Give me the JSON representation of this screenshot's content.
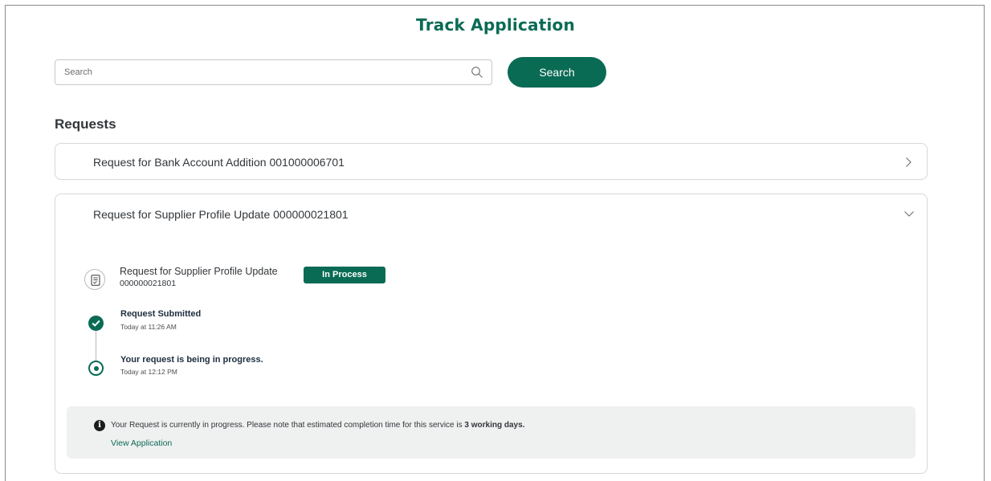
{
  "page": {
    "title": "Track Application"
  },
  "search": {
    "placeholder": "Search",
    "value": "",
    "button_label": "Search"
  },
  "requests": {
    "heading": "Requests",
    "items": [
      {
        "title": "Request for Bank Account Addition 001000006701",
        "expanded": false
      },
      {
        "title": "Request for Supplier Profile Update 000000021801",
        "expanded": true,
        "detail": {
          "name": "Request for Supplier Profile Update",
          "number": "000000021801",
          "status": "In Process",
          "steps": [
            {
              "title": "Request Submitted",
              "time": "Today at 11:26 AM",
              "state": "done"
            },
            {
              "title": "Your request is being in progress.",
              "time": "Today at 12:12 PM",
              "state": "current"
            }
          ],
          "info": {
            "text_prefix": "Your Request is currently in progress. Please note that estimated completion time for this service is ",
            "text_bold": "3 working days.",
            "link_label": "View Application"
          }
        }
      }
    ]
  },
  "colors": {
    "accent": "#0a6b55",
    "panel_bg": "#eff0f0",
    "border": "#d5d7d9"
  },
  "icons": {
    "search": "search-icon",
    "expand": "chevron-right-icon",
    "collapse": "chevron-down-icon",
    "document": "document-icon",
    "step_done": "check-circle-icon",
    "step_current": "radio-circle-icon",
    "info": "info-icon"
  }
}
